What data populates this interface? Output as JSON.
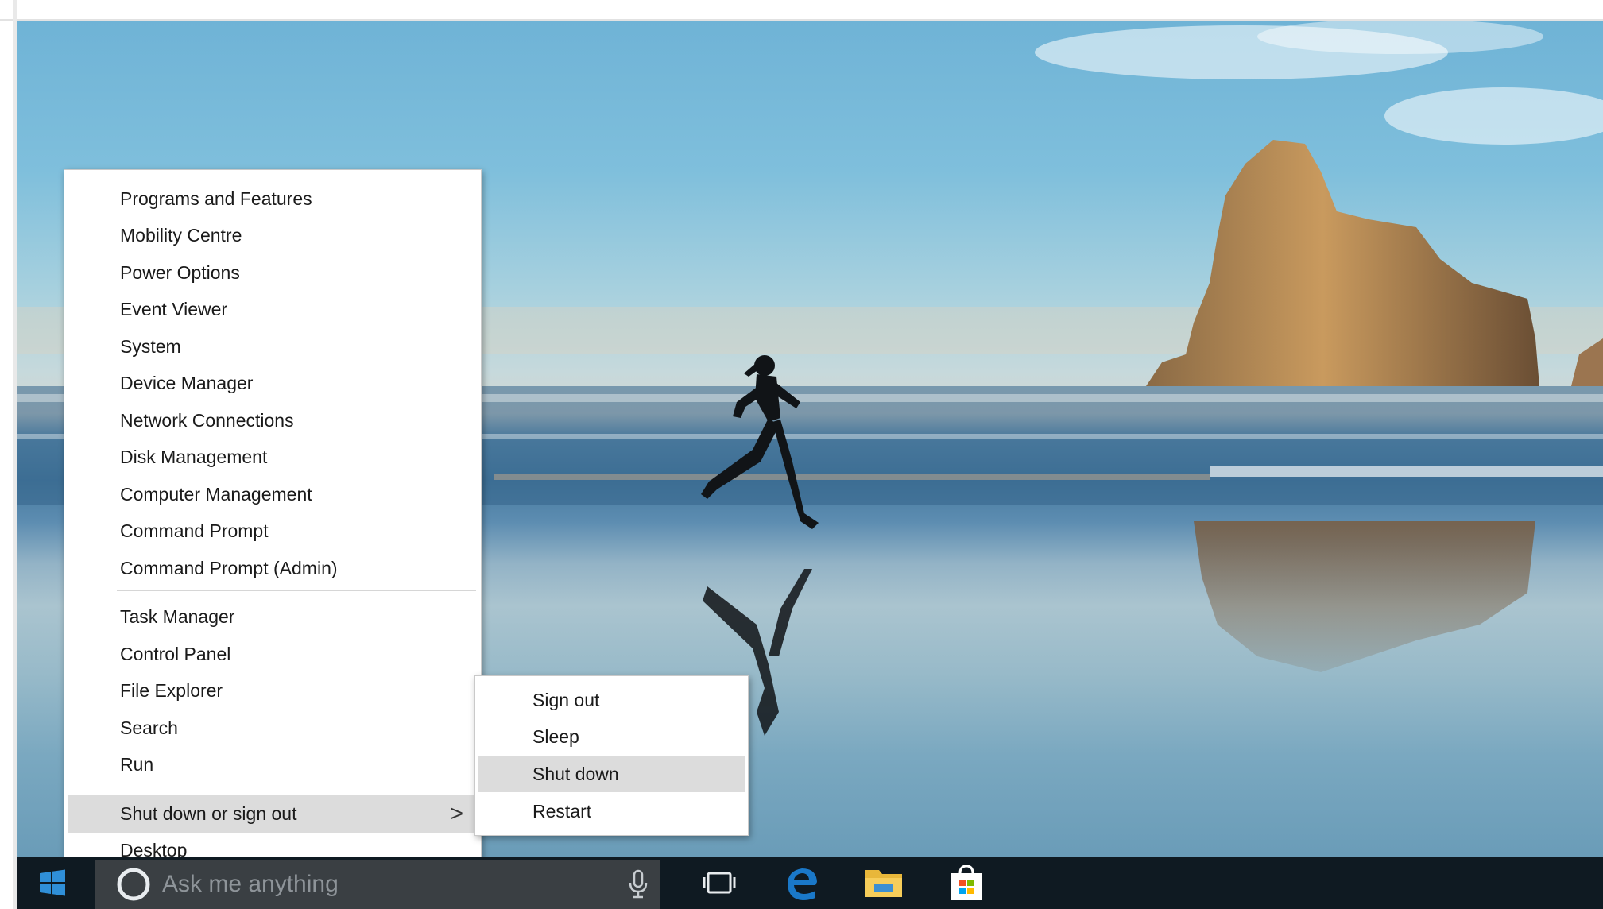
{
  "context_menu": {
    "items": [
      {
        "label": "Programs and Features"
      },
      {
        "label": "Mobility Centre"
      },
      {
        "label": "Power Options"
      },
      {
        "label": "Event Viewer"
      },
      {
        "label": "System"
      },
      {
        "label": "Device Manager"
      },
      {
        "label": "Network Connections"
      },
      {
        "label": "Disk Management"
      },
      {
        "label": "Computer Management"
      },
      {
        "label": "Command Prompt"
      },
      {
        "label": "Command Prompt (Admin)"
      },
      {
        "label": "Task Manager"
      },
      {
        "label": "Control Panel"
      },
      {
        "label": "File Explorer"
      },
      {
        "label": "Search"
      },
      {
        "label": "Run"
      },
      {
        "label": "Shut down or sign out",
        "highlighted": true,
        "has_submenu": true
      },
      {
        "label": "Desktop"
      }
    ],
    "submenu_arrow": ">"
  },
  "submenu": {
    "items": [
      {
        "label": "Sign out"
      },
      {
        "label": "Sleep"
      },
      {
        "label": "Shut down",
        "highlighted": true
      },
      {
        "label": "Restart"
      }
    ]
  },
  "taskbar": {
    "search_placeholder": "Ask me anything",
    "icons": [
      "windows-start-icon",
      "cortana-icon",
      "microphone-icon",
      "task-view-icon",
      "edge-icon",
      "file-explorer-icon",
      "store-icon"
    ]
  },
  "colors": {
    "taskbar": "#0f1a22",
    "search_box": "#3a3f43",
    "menu_highlight": "#dcdcdc",
    "edge_blue": "#1a78c8",
    "folder_yellow": "#e8b73a",
    "start_blue": "#2f8fd8"
  }
}
